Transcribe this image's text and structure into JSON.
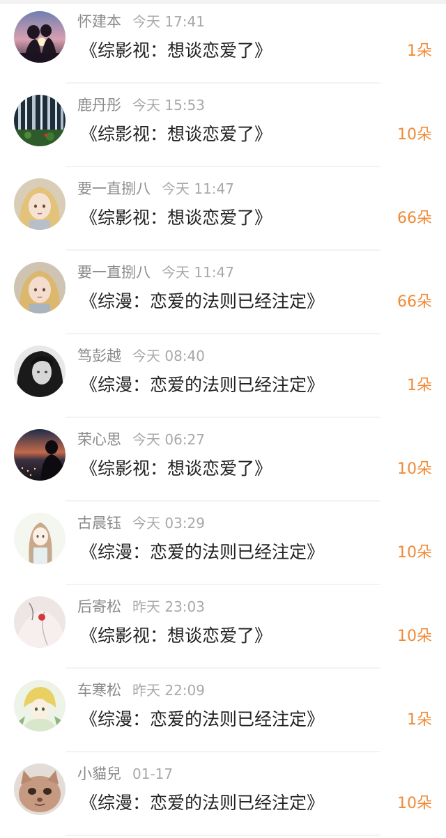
{
  "gift_list": {
    "items": [
      {
        "name": "怀建本",
        "time": "今天 17:41",
        "title": "《综影视：想谈恋爱了》",
        "amount": "1朵",
        "avatar_icon": "couple-sunset-avatar"
      },
      {
        "name": "鹿丹彤",
        "time": "今天 15:53",
        "title": "《综影视：想谈恋爱了》",
        "amount": "10朵",
        "avatar_icon": "forest-avatar"
      },
      {
        "name": "要一直捌八",
        "time": "今天 11:47",
        "title": "《综影视：想谈恋爱了》",
        "amount": "66朵",
        "avatar_icon": "anime-girl-avatar"
      },
      {
        "name": "要一直捌八",
        "time": "今天 11:47",
        "title": "《综漫：恋爱的法则已经注定》",
        "amount": "66朵",
        "avatar_icon": "anime-girl-avatar"
      },
      {
        "name": "笃彭越",
        "time": "今天 08:40",
        "title": "《综漫：恋爱的法则已经注定》",
        "amount": "1朵",
        "avatar_icon": "dark-hair-girl-avatar"
      },
      {
        "name": "荣心思",
        "time": "今天 06:27",
        "title": "《综影视：想谈恋爱了》",
        "amount": "10朵",
        "avatar_icon": "night-city-avatar"
      },
      {
        "name": "古晨钰",
        "time": "今天 03:29",
        "title": "《综漫：恋爱的法则已经注定》",
        "amount": "10朵",
        "avatar_icon": "sketch-girl-avatar"
      },
      {
        "name": "后寄松",
        "time": "昨天 23:03",
        "title": "《综影视：想谈恋爱了》",
        "amount": "10朵",
        "avatar_icon": "pale-figure-avatar"
      },
      {
        "name": "车寒松",
        "time": "昨天 22:09",
        "title": "《综漫：恋爱的法则已经注定》",
        "amount": "1朵",
        "avatar_icon": "anime-blond-avatar"
      },
      {
        "name": "小貓兒",
        "time": "01-17",
        "title": "《综漫：恋爱的法则已经注定》",
        "amount": "10朵",
        "avatar_icon": "cat-avatar"
      }
    ]
  },
  "colors": {
    "amount": "#f08a36",
    "name": "#8a8a8a",
    "time": "#a9a9a9",
    "title": "#222222"
  }
}
